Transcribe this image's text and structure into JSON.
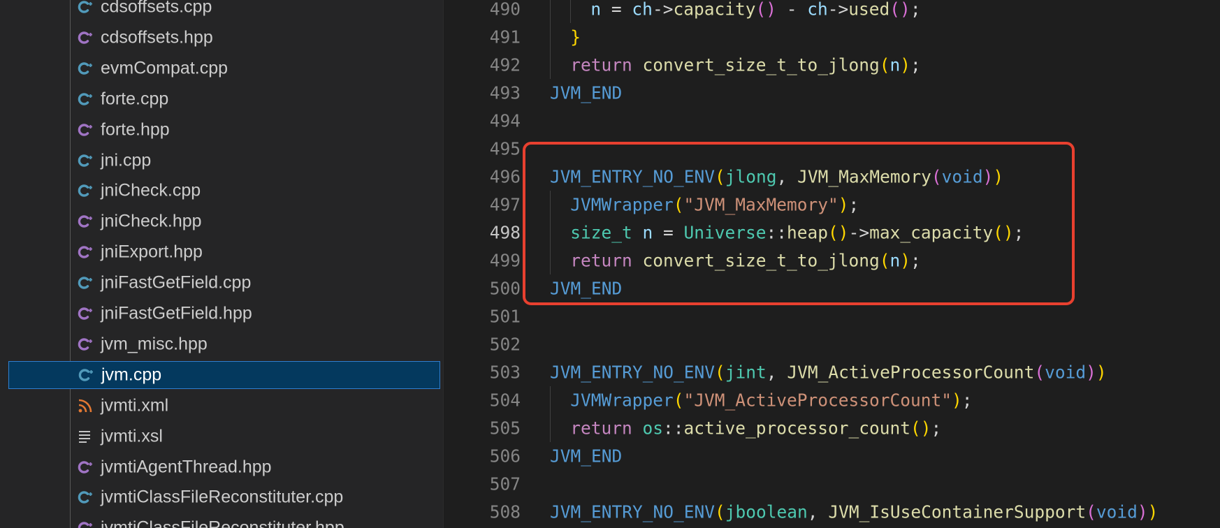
{
  "colors": {
    "editor_bg": "#1e1e1e",
    "sidebar_bg": "#252526",
    "selection_bg": "#04395e",
    "selection_border": "#2f7fd0",
    "annotation_box": "#e8402f",
    "cpp_icon": "#519aba",
    "hpp_icon": "#a074c4",
    "xml_icon": "#e37933"
  },
  "explorer": {
    "files": [
      {
        "name": "cdsoffsets.cpp",
        "icon": "cpp-file-icon"
      },
      {
        "name": "cdsoffsets.hpp",
        "icon": "hpp-file-icon"
      },
      {
        "name": "evmCompat.cpp",
        "icon": "cpp-file-icon"
      },
      {
        "name": "forte.cpp",
        "icon": "cpp-file-icon"
      },
      {
        "name": "forte.hpp",
        "icon": "hpp-file-icon"
      },
      {
        "name": "jni.cpp",
        "icon": "cpp-file-icon"
      },
      {
        "name": "jniCheck.cpp",
        "icon": "cpp-file-icon"
      },
      {
        "name": "jniCheck.hpp",
        "icon": "hpp-file-icon"
      },
      {
        "name": "jniExport.hpp",
        "icon": "hpp-file-icon"
      },
      {
        "name": "jniFastGetField.cpp",
        "icon": "cpp-file-icon"
      },
      {
        "name": "jniFastGetField.hpp",
        "icon": "hpp-file-icon"
      },
      {
        "name": "jvm_misc.hpp",
        "icon": "hpp-file-icon"
      },
      {
        "name": "jvm.cpp",
        "icon": "cpp-file-icon",
        "selected": true
      },
      {
        "name": "jvmti.xml",
        "icon": "xml-file-icon"
      },
      {
        "name": "jvmti.xsl",
        "icon": "text-file-icon"
      },
      {
        "name": "jvmtiAgentThread.hpp",
        "icon": "hpp-file-icon"
      },
      {
        "name": "jvmtiClassFileReconstituter.cpp",
        "icon": "cpp-file-icon"
      },
      {
        "name": "jvmtiClassFileReconstituter.hpp",
        "icon": "hpp-file-icon"
      }
    ]
  },
  "editor": {
    "active_line": "498",
    "lines": [
      {
        "no": "490",
        "indent": 2,
        "tokens": [
          [
            "n",
            "var"
          ],
          [
            " = ",
            "op"
          ],
          [
            "ch",
            "var"
          ],
          [
            "->",
            "op"
          ],
          [
            "capacity",
            "fn"
          ],
          [
            "()",
            "p2"
          ],
          [
            " - ",
            "op"
          ],
          [
            "ch",
            "var"
          ],
          [
            "->",
            "op"
          ],
          [
            "used",
            "fn"
          ],
          [
            "()",
            "p2"
          ],
          [
            ";",
            "op"
          ]
        ]
      },
      {
        "no": "491",
        "indent": 1,
        "tokens": [
          [
            "}",
            "p1"
          ]
        ]
      },
      {
        "no": "492",
        "indent": 1,
        "tokens": [
          [
            "return",
            "kw"
          ],
          [
            " ",
            "op"
          ],
          [
            "convert_size_t_to_jlong",
            "fn"
          ],
          [
            "(",
            "p1"
          ],
          [
            "n",
            "var"
          ],
          [
            ")",
            "p1"
          ],
          [
            ";",
            "op"
          ]
        ]
      },
      {
        "no": "493",
        "indent": 0,
        "tokens": [
          [
            "JVM_END",
            "macro"
          ]
        ]
      },
      {
        "no": "494",
        "indent": 0,
        "tokens": []
      },
      {
        "no": "495",
        "indent": 0,
        "tokens": []
      },
      {
        "no": "496",
        "indent": 0,
        "tokens": [
          [
            "JVM_ENTRY_NO_ENV",
            "macro"
          ],
          [
            "(",
            "p1"
          ],
          [
            "jlong",
            "type"
          ],
          [
            ", ",
            "op"
          ],
          [
            "JVM_MaxMemory",
            "fn"
          ],
          [
            "(",
            "p2"
          ],
          [
            "void",
            "kwb"
          ],
          [
            ")",
            "p2"
          ],
          [
            ")",
            "p1"
          ]
        ]
      },
      {
        "no": "497",
        "indent": 1,
        "tokens": [
          [
            "JVMWrapper",
            "macro"
          ],
          [
            "(",
            "p1"
          ],
          [
            "\"JVM_MaxMemory\"",
            "str"
          ],
          [
            ")",
            "p1"
          ],
          [
            ";",
            "op"
          ]
        ]
      },
      {
        "no": "498",
        "indent": 1,
        "tokens": [
          [
            "size_t",
            "type"
          ],
          [
            " ",
            "op"
          ],
          [
            "n",
            "var"
          ],
          [
            " = ",
            "op"
          ],
          [
            "Universe",
            "type"
          ],
          [
            "::",
            "op"
          ],
          [
            "heap",
            "fn"
          ],
          [
            "()",
            "p1"
          ],
          [
            "->",
            "op"
          ],
          [
            "max_capacity",
            "fn"
          ],
          [
            "()",
            "p1"
          ],
          [
            ";",
            "op"
          ]
        ]
      },
      {
        "no": "499",
        "indent": 1,
        "tokens": [
          [
            "return",
            "kw"
          ],
          [
            " ",
            "op"
          ],
          [
            "convert_size_t_to_jlong",
            "fn"
          ],
          [
            "(",
            "p1"
          ],
          [
            "n",
            "var"
          ],
          [
            ")",
            "p1"
          ],
          [
            ";",
            "op"
          ]
        ]
      },
      {
        "no": "500",
        "indent": 0,
        "tokens": [
          [
            "JVM_END",
            "macro"
          ]
        ]
      },
      {
        "no": "501",
        "indent": 0,
        "tokens": []
      },
      {
        "no": "502",
        "indent": 0,
        "tokens": []
      },
      {
        "no": "503",
        "indent": 0,
        "tokens": [
          [
            "JVM_ENTRY_NO_ENV",
            "macro"
          ],
          [
            "(",
            "p1"
          ],
          [
            "jint",
            "type"
          ],
          [
            ", ",
            "op"
          ],
          [
            "JVM_ActiveProcessorCount",
            "fn"
          ],
          [
            "(",
            "p2"
          ],
          [
            "void",
            "kwb"
          ],
          [
            ")",
            "p2"
          ],
          [
            ")",
            "p1"
          ]
        ]
      },
      {
        "no": "504",
        "indent": 1,
        "tokens": [
          [
            "JVMWrapper",
            "macro"
          ],
          [
            "(",
            "p1"
          ],
          [
            "\"JVM_ActiveProcessorCount\"",
            "str"
          ],
          [
            ")",
            "p1"
          ],
          [
            ";",
            "op"
          ]
        ]
      },
      {
        "no": "505",
        "indent": 1,
        "tokens": [
          [
            "return",
            "kw"
          ],
          [
            " ",
            "op"
          ],
          [
            "os",
            "type"
          ],
          [
            "::",
            "op"
          ],
          [
            "active_processor_count",
            "fn"
          ],
          [
            "()",
            "p1"
          ],
          [
            ";",
            "op"
          ]
        ]
      },
      {
        "no": "506",
        "indent": 0,
        "tokens": [
          [
            "JVM_END",
            "macro"
          ]
        ]
      },
      {
        "no": "507",
        "indent": 0,
        "tokens": []
      },
      {
        "no": "508",
        "indent": 0,
        "tokens": [
          [
            "JVM_ENTRY_NO_ENV",
            "macro"
          ],
          [
            "(",
            "p1"
          ],
          [
            "jboolean",
            "type"
          ],
          [
            ", ",
            "op"
          ],
          [
            "JVM_IsUseContainerSupport",
            "fn"
          ],
          [
            "(",
            "p2"
          ],
          [
            "void",
            "kwb"
          ],
          [
            ")",
            "p2"
          ],
          [
            ")",
            "p1"
          ]
        ]
      }
    ]
  }
}
